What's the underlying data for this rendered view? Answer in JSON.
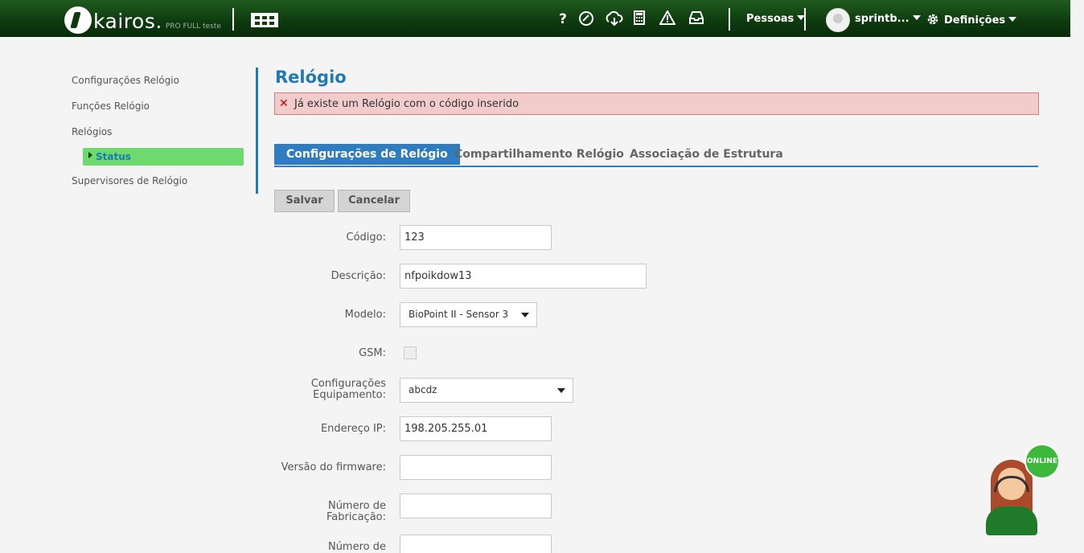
{
  "header": {
    "brand": "kairos.",
    "edition": "PRO FULL teste",
    "icons": [
      "help-icon",
      "support-icon",
      "cloud-download-icon",
      "calculator-icon",
      "warning-icon",
      "inbox-icon"
    ],
    "pessoas_label": "Pessoas",
    "user_name": "sprintb...",
    "settings_label": "Definições"
  },
  "sidebar": {
    "items": [
      {
        "label": "Configurações Relógio"
      },
      {
        "label": "Funções Relógio"
      },
      {
        "label": "Relógios"
      },
      {
        "label": "Status"
      },
      {
        "label": "Supervisores de Relógio"
      }
    ]
  },
  "main": {
    "title": "Relógio",
    "alert": "Já existe um Relógio com o código inserido",
    "tabs": [
      {
        "label": "Configurações de Relógio"
      },
      {
        "label": "Compartilhamento Relógio"
      },
      {
        "label": "Associação de Estrutura"
      }
    ],
    "buttons": {
      "save": "Salvar",
      "cancel": "Cancelar"
    },
    "fields": {
      "codigo": {
        "label": "Código:",
        "value": "123"
      },
      "descricao": {
        "label": "Descrição:",
        "value": "nfpoikdow13"
      },
      "modelo": {
        "label": "Modelo:",
        "value": "BioPoint II - Sensor 3"
      },
      "gsm": {
        "label": "GSM:",
        "checked": false
      },
      "config_equip": {
        "label_1": "Configurações",
        "label_2": "Equipamento:",
        "value": "abcdz"
      },
      "endereco_ip": {
        "label": "Endereço IP:",
        "value": "198.205.255.01"
      },
      "versao_firmware": {
        "label": "Versão do firmware:",
        "value": ""
      },
      "numero_fabricacao": {
        "label_1": "Número de",
        "label_2": "Fabricação:",
        "value": ""
      },
      "numero_de": {
        "label_1": "Número de",
        "value": ""
      }
    }
  },
  "chat": {
    "status": "ONLINE"
  }
}
